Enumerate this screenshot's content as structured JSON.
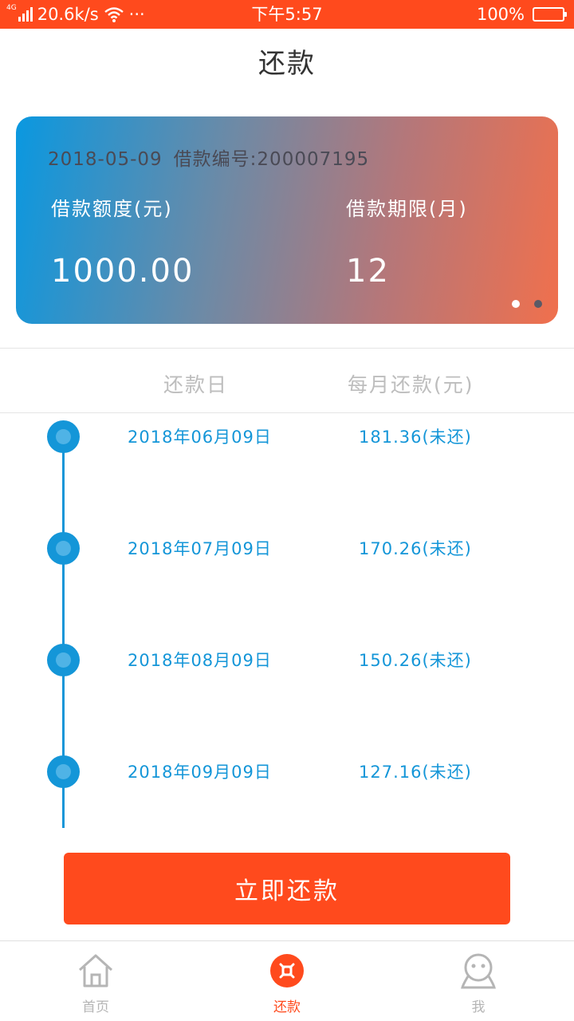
{
  "status_bar": {
    "network": "4G",
    "speed": "20.6k/s",
    "more": "···",
    "time": "下午5:57",
    "battery": "100%",
    "bg_color": "#ff4a1d"
  },
  "page": {
    "title": "还款"
  },
  "loan_card": {
    "date": "2018-05-09",
    "loan_no": "借款编号:200007195",
    "amount_label": "借款额度(元)",
    "amount_value": "1000.00",
    "term_label": "借款期限(月)",
    "term_value": "12",
    "pager": {
      "count": 2,
      "active_index": 0
    },
    "gradient_colors": [
      "#0a98e0",
      "#f0704d"
    ]
  },
  "schedule": {
    "headers": {
      "date": "还款日",
      "amount": "每月还款(元)"
    },
    "rows": [
      {
        "date": "2018年06月09日",
        "amount": "181.36(未还)"
      },
      {
        "date": "2018年07月09日",
        "amount": "170.26(未还)"
      },
      {
        "date": "2018年08月09日",
        "amount": "150.26(未还)"
      },
      {
        "date": "2018年09月09日",
        "amount": "127.16(未还)"
      }
    ],
    "accent_color": "#1496d8"
  },
  "actions": {
    "pay_now": "立即还款",
    "accent_color": "#ff4a1d"
  },
  "bottom_nav": {
    "items": [
      {
        "label": "首页",
        "icon": "home-icon",
        "active": false
      },
      {
        "label": "还款",
        "icon": "repay-icon",
        "active": true
      },
      {
        "label": "我",
        "icon": "user-icon",
        "active": false
      }
    ]
  }
}
